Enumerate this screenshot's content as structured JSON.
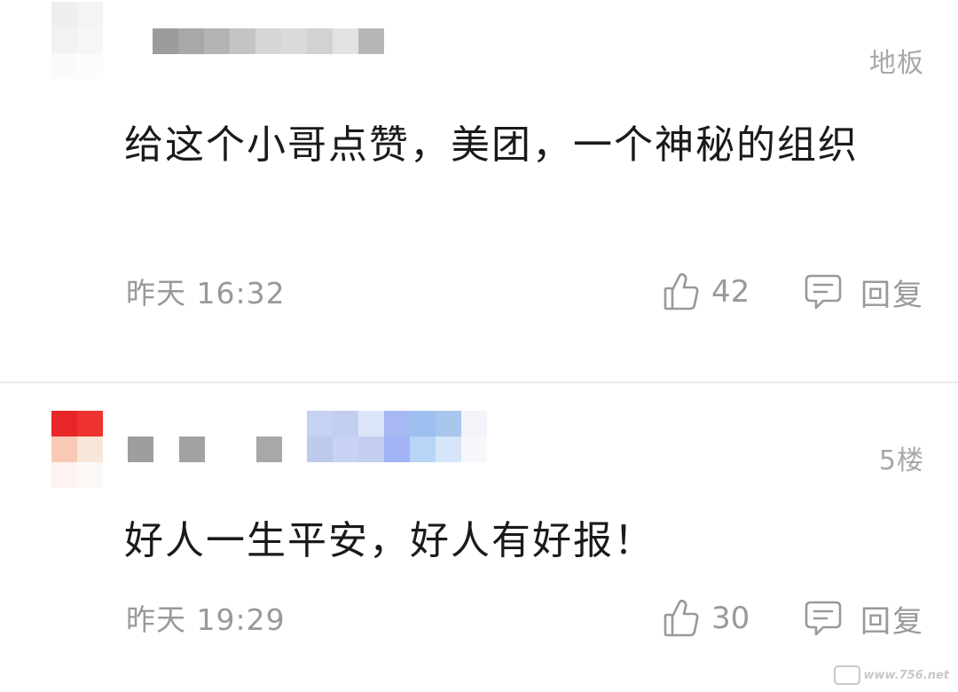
{
  "comments": [
    {
      "floor": "地板",
      "text": "给这个小哥点赞，美团，一个神秘的组织",
      "time": "昨天 16:32",
      "likes": "42",
      "reply_label": "回复",
      "avatar_colors": [
        "#f0f0f0",
        "#f6f6f6",
        "#f3f3f3",
        "#f8f8f8"
      ],
      "username_colors": [
        "#9a9a9a",
        "#a6a6a6",
        "#b8b8b8",
        "#c2c2c2",
        "#d4d4d4",
        "#dcdcdc",
        "#d0d0d0",
        "#e0e0e0",
        "#b0b0b0"
      ]
    },
    {
      "floor": "5楼",
      "text": "好人一生平安，好人有好报！",
      "time": "昨天 19:29",
      "likes": "30",
      "reply_label": "回复",
      "avatar_colors": [
        "#e8282c",
        "#f0342f",
        "#f8c8b8",
        "#f8e8dc"
      ],
      "username_colors": [
        "#9e9e9e",
        "#ffffff",
        "#a4a4a4",
        "#ffffff",
        "#ababab",
        "#c8d4f0",
        "#b8c8ec",
        "#9cb0f4",
        "#a4c8f0"
      ]
    }
  ],
  "watermark": {
    "text": "www.756.net"
  },
  "colors": {
    "text": "#1a1a1a",
    "meta": "#999999",
    "divider": "#ebebeb"
  }
}
